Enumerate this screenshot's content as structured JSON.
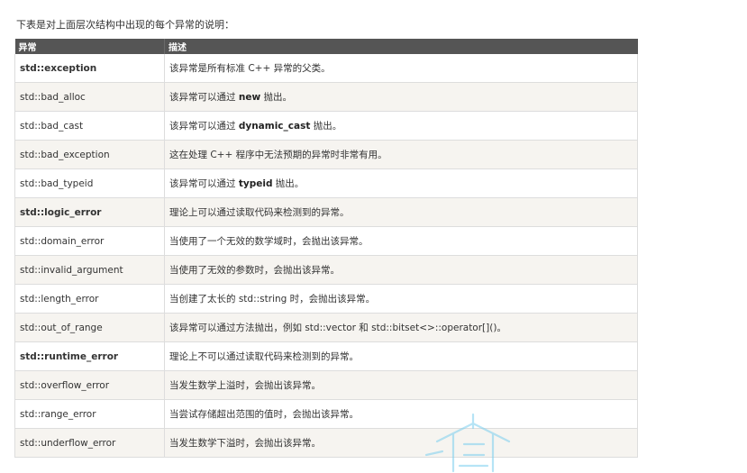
{
  "intro": "下表是对上面层次结构中出现的每个异常的说明：",
  "table": {
    "headers": [
      "异常",
      "描述"
    ],
    "rows": [
      {
        "name": "std::exception",
        "bold": true,
        "desc": [
          {
            "t": "该异常是所有标准 C++ 异常的父类。"
          }
        ]
      },
      {
        "name": "std::bad_alloc",
        "bold": false,
        "desc": [
          {
            "t": "该异常可以通过 "
          },
          {
            "t": "new",
            "code": true
          },
          {
            "t": " 抛出。"
          }
        ]
      },
      {
        "name": "std::bad_cast",
        "bold": false,
        "desc": [
          {
            "t": "该异常可以通过 "
          },
          {
            "t": "dynamic_cast",
            "code": true
          },
          {
            "t": " 抛出。"
          }
        ]
      },
      {
        "name": "std::bad_exception",
        "bold": false,
        "desc": [
          {
            "t": "这在处理 C++ 程序中无法预期的异常时非常有用。"
          }
        ]
      },
      {
        "name": "std::bad_typeid",
        "bold": false,
        "desc": [
          {
            "t": "该异常可以通过 "
          },
          {
            "t": "typeid",
            "code": true
          },
          {
            "t": " 抛出。"
          }
        ]
      },
      {
        "name": "std::logic_error",
        "bold": true,
        "desc": [
          {
            "t": "理论上可以通过读取代码来检测到的异常。"
          }
        ]
      },
      {
        "name": "std::domain_error",
        "bold": false,
        "desc": [
          {
            "t": "当使用了一个无效的数学域时，会抛出该异常。"
          }
        ]
      },
      {
        "name": "std::invalid_argument",
        "bold": false,
        "desc": [
          {
            "t": "当使用了无效的参数时，会抛出该异常。"
          }
        ]
      },
      {
        "name": "std::length_error",
        "bold": false,
        "desc": [
          {
            "t": "当创建了太长的 std::string 时，会抛出该异常。"
          }
        ]
      },
      {
        "name": "std::out_of_range",
        "bold": false,
        "desc": [
          {
            "t": "该异常可以通过方法抛出，例如 std::vector 和 std::bitset<>::operator[]()。"
          }
        ]
      },
      {
        "name": "std::runtime_error",
        "bold": true,
        "desc": [
          {
            "t": "理论上不可以通过读取代码来检测到的异常。"
          }
        ]
      },
      {
        "name": "std::overflow_error",
        "bold": false,
        "desc": [
          {
            "t": "当发生数学上溢时，会抛出该异常。"
          }
        ]
      },
      {
        "name": "std::range_error",
        "bold": false,
        "desc": [
          {
            "t": "当尝试存储超出范围的值时，会抛出该异常。"
          }
        ]
      },
      {
        "name": "std::underflow_error",
        "bold": false,
        "desc": [
          {
            "t": "当发生数学下溢时，会抛出该异常。"
          }
        ]
      }
    ]
  },
  "colors": {
    "header_bg": "#555555",
    "row_alt_bg": "#f6f4f0",
    "watermark": "#7ccfef"
  }
}
